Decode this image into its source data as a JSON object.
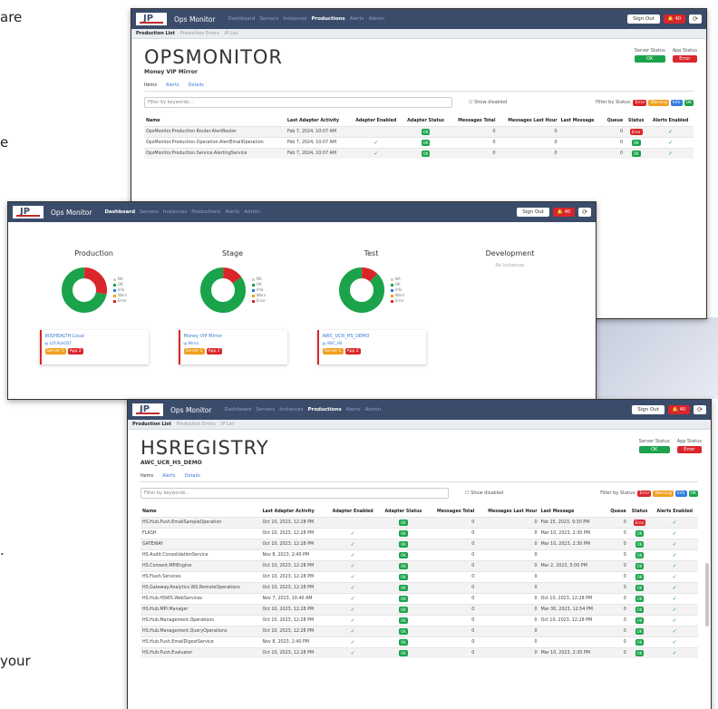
{
  "background_fragments": [
    "are",
    "e",
    ".",
    "your"
  ],
  "nav": {
    "brand": "Ops Monitor",
    "links": [
      "Dashboard",
      "Servers",
      "Instances",
      "Productions",
      "Alerts",
      "Admin"
    ],
    "sign_out": "Sign Out",
    "bell": "40",
    "sync": "⟳"
  },
  "subnav": [
    "Production List",
    "Production Errors",
    "IP List"
  ],
  "status_labels": {
    "server": "Server Status",
    "app": "App Status",
    "ok": "OK",
    "error": "Error"
  },
  "tabs": [
    "Items",
    "Alerts",
    "Details"
  ],
  "filter": {
    "placeholder": "Filter by keywords...",
    "show_disabled": "Show disabled",
    "by_status": "Filter by Status:",
    "pills": [
      "Error",
      "Warning",
      "Info",
      "OK"
    ]
  },
  "columns": [
    "Name",
    "Last Adapter Activity",
    "Adapter Enabled",
    "Adapter Status",
    "Messages Total",
    "Messages Last Hour",
    "Last Message",
    "Queue",
    "Status",
    "Alerts Enabled"
  ],
  "colors": {
    "nav": "#3b4c6b",
    "ok": "#1aa34a",
    "error": "#d9262b",
    "warning": "#f0a020",
    "info": "#2f7de1"
  },
  "win1": {
    "title": "OPSMONITOR",
    "subtitle": "Money VIP Mirror",
    "rows": [
      [
        "OpsMonitor.Production.Router.AlertRouter",
        "Feb 7, 2024, 10:07 AM",
        "",
        "OK",
        "0",
        "0",
        "",
        "0",
        "Error",
        "✓"
      ],
      [
        "OpsMonitor.Production.Operation.AlertEmailOperation",
        "Feb 7, 2024, 10:07 AM",
        "✓",
        "OK",
        "0",
        "0",
        "",
        "0",
        "OK",
        "✓"
      ],
      [
        "OpsMonitor.Production.Service.AlertingService",
        "Feb 7, 2024, 10:07 AM",
        "✓",
        "OK",
        "0",
        "0",
        "",
        "0",
        "OK",
        "✓"
      ]
    ]
  },
  "win2": {
    "columns": [
      {
        "title": "Production",
        "card": {
          "name": "IRISHEALTH Local",
          "server": "LOCALHOST",
          "badges": [
            "Server 1",
            "App 2"
          ]
        }
      },
      {
        "title": "Stage",
        "card": {
          "name": "Money VIP Mirror",
          "server": "Mirror",
          "badges": [
            "Server 1",
            "App 2"
          ]
        }
      },
      {
        "title": "Test",
        "card": {
          "name": "AWC_UCR_HS_DEMO",
          "server": "AWC_HS",
          "badges": [
            "Server 1",
            "App 2"
          ]
        }
      },
      {
        "title": "Development",
        "none": "No Instances"
      }
    ],
    "legend": [
      "NA",
      "OK",
      "Info",
      "Warn",
      "Error"
    ]
  },
  "win3": {
    "title": "HSREGISTRY",
    "subtitle": "AWC_UCR_HS_DEMO",
    "rows": [
      [
        "HS.Hub.Push.EmailSampleOperation",
        "Oct 10, 2023, 12:28 PM",
        "",
        "OK",
        "0",
        "0",
        "Feb 15, 2023, 9:30 PM",
        "0",
        "Error",
        "✓"
      ],
      [
        "FLASH",
        "Oct 10, 2023, 12:28 PM",
        "✓",
        "OK",
        "0",
        "0",
        "Mar 10, 2023, 2:30 PM",
        "0",
        "OK",
        "✓"
      ],
      [
        "GATEWAY",
        "Oct 10, 2023, 12:28 PM",
        "✓",
        "OK",
        "0",
        "0",
        "Mar 10, 2023, 2:30 PM",
        "0",
        "OK",
        "✓"
      ],
      [
        "HS.Audit.ConsolidationService",
        "Nov 8, 2023, 2:40 PM",
        "✓",
        "OK",
        "0",
        "0",
        "",
        "0",
        "OK",
        "✓"
      ],
      [
        "HS.Consent.MPIEngine",
        "Oct 10, 2023, 12:28 PM",
        "✓",
        "OK",
        "0",
        "0",
        "Mar 2, 2023, 5:00 PM",
        "0",
        "OK",
        "✓"
      ],
      [
        "HS.Flash.Services",
        "Oct 10, 2023, 12:28 PM",
        "✓",
        "OK",
        "0",
        "0",
        "",
        "0",
        "OK",
        "✓"
      ],
      [
        "HS.Gateway.Analytics.WS.RemoteOperations",
        "Oct 10, 2023, 12:28 PM",
        "✓",
        "OK",
        "0",
        "0",
        "",
        "0",
        "OK",
        "✓"
      ],
      [
        "HS.Hub.HSWS.WebServices",
        "Nov 7, 2023, 10:40 AM",
        "✓",
        "OK",
        "0",
        "0",
        "Oct 10, 2023, 12:28 PM",
        "0",
        "OK",
        "✓"
      ],
      [
        "HS.Hub.MPI.Manager",
        "Oct 10, 2023, 12:28 PM",
        "✓",
        "OK",
        "0",
        "0",
        "Mar 30, 2023, 12:54 PM",
        "0",
        "OK",
        "✓"
      ],
      [
        "HS.Hub.Management.Operations",
        "Oct 10, 2023, 12:28 PM",
        "✓",
        "OK",
        "0",
        "0",
        "Oct 10, 2023, 12:28 PM",
        "0",
        "OK",
        "✓"
      ],
      [
        "HS.Hub.Management.QueryOperations",
        "Oct 10, 2023, 12:28 PM",
        "✓",
        "OK",
        "0",
        "0",
        "",
        "0",
        "OK",
        "✓"
      ],
      [
        "HS.Hub.Push.EmailDigestService",
        "Nov 8, 2023, 2:40 PM",
        "✓",
        "OK",
        "0",
        "0",
        "",
        "0",
        "OK",
        "✓"
      ],
      [
        "HS.Hub.Push.Evaluator",
        "Oct 10, 2023, 12:28 PM",
        "✓",
        "OK",
        "0",
        "0",
        "Mar 10, 2023, 2:30 PM",
        "0",
        "OK",
        "✓"
      ]
    ]
  }
}
